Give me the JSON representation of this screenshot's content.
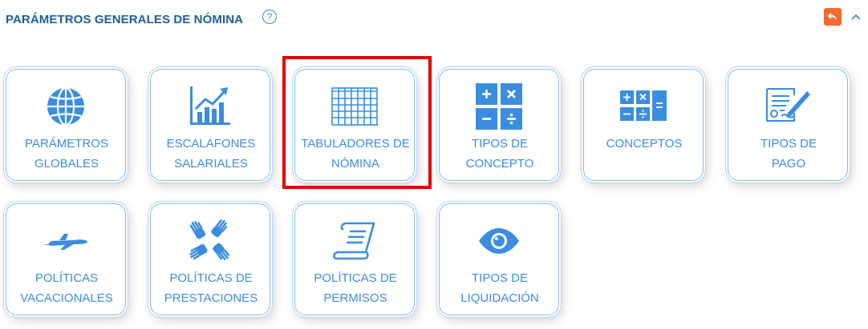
{
  "header": {
    "title": "PARÁMETROS GENERALES DE NÓMINA",
    "help_icon_glyph": "?",
    "back_icon": "undo-arrow-icon",
    "collapse_icon": "chevron-up-icon",
    "accent_color": "#3b8de0",
    "back_color": "#f26a2e"
  },
  "tiles": [
    {
      "line1": "PARÁMETROS",
      "line2": "GLOBALES",
      "icon": "globe-icon"
    },
    {
      "line1": "ESCALAFONES",
      "line2": "SALARIALES",
      "icon": "growth-chart-icon"
    },
    {
      "line1": "TABULADORES DE",
      "line2": "NÓMINA",
      "icon": "table-grid-icon"
    },
    {
      "line1": "TIPOS DE",
      "line2": "CONCEPTO",
      "icon": "calculator-operations-icon"
    },
    {
      "line1": "CONCEPTOS",
      "line2": "",
      "icon": "calculator-icon"
    },
    {
      "line1": "TIPOS DE",
      "line2": "PAGO",
      "icon": "signed-document-icon"
    },
    {
      "line1": "POLÍTICAS",
      "line2": "VACACIONALES",
      "icon": "airplane-icon"
    },
    {
      "line1": "POLÍTICAS DE",
      "line2": "PRESTACIONES",
      "icon": "hands-icon"
    },
    {
      "line1": "POLÍTICAS DE",
      "line2": "PERMISOS",
      "icon": "scroll-icon"
    },
    {
      "line1": "TIPOS DE",
      "line2": "LIQUIDACIÓN",
      "icon": "eye-icon"
    }
  ],
  "highlighted_tile": "TABULADORES DE NÓMINA",
  "highlight_color": "#e30000"
}
